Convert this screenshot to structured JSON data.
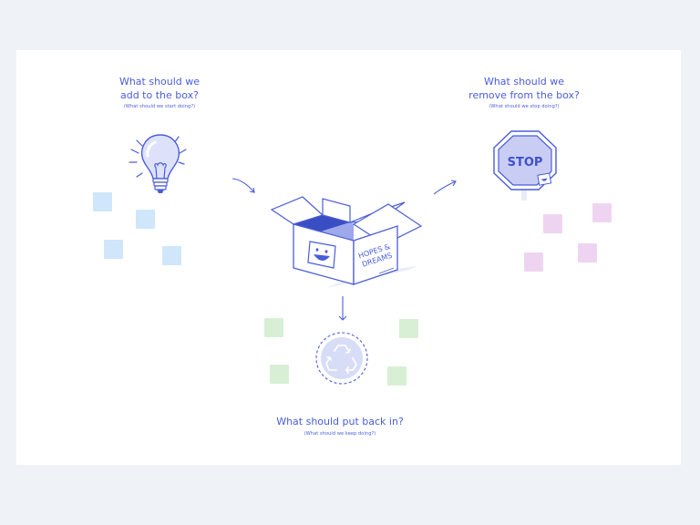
{
  "sections": {
    "add": {
      "title": "What should we\nadd to the box?",
      "hint": "(What should we start doing?)"
    },
    "remove": {
      "title": "What should we\nremove from the box?",
      "hint": "(What should we stop doing?)"
    },
    "keep": {
      "title": "What should put back in?",
      "hint": "(What should we keep doing?)"
    }
  },
  "box": {
    "label_line1": "HOPES &",
    "label_line2": "DREAMS"
  },
  "stop_sign": {
    "label": "STOP"
  },
  "icons": [
    "lightbulb-icon",
    "stop-sign-icon",
    "box-icon",
    "recycle-icon",
    "smiley-sticker-icon"
  ],
  "colors": {
    "accent": "#4a5dd8",
    "board": "#ffffff",
    "background": "#eff2f6",
    "note_blue": "#cfe6fb",
    "note_green": "#d8efd6",
    "note_pink": "#efd4f1"
  }
}
